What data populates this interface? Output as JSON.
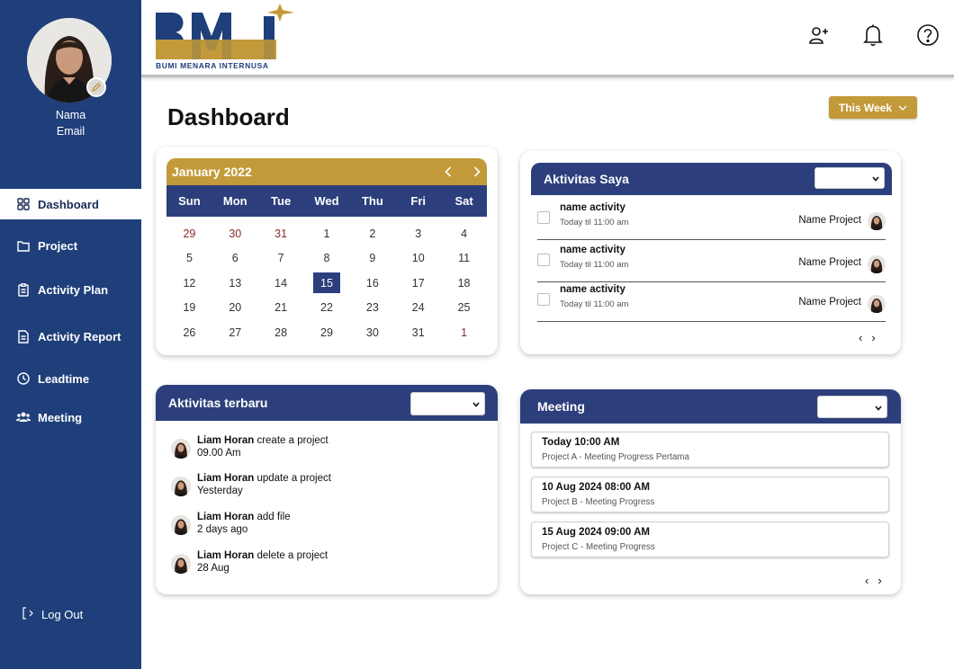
{
  "brand": {
    "logo_text": "BMI",
    "subtitle": "BUMI MENARA INTERNUSA",
    "colors": {
      "navy": "#1f3f7a",
      "gold": "#c39a3a",
      "panel": "#2c3f7c"
    }
  },
  "profile": {
    "name": "Nama",
    "email": "Email"
  },
  "sidebar": {
    "items": [
      {
        "label": "Dashboard",
        "icon": "grid-icon",
        "active": true
      },
      {
        "label": "Project",
        "icon": "folder-icon"
      },
      {
        "label": "Activity Plan",
        "icon": "clipboard-icon"
      },
      {
        "label": "Activity Report",
        "icon": "document-icon"
      },
      {
        "label": "Leadtime",
        "icon": "clock-icon"
      },
      {
        "label": "Meeting",
        "icon": "users-icon"
      }
    ],
    "logout": "Log Out"
  },
  "header": {
    "icons": [
      "add-user-icon",
      "bell-icon",
      "help-icon"
    ]
  },
  "page": {
    "title": "Dashboard",
    "filter": "This Week"
  },
  "calendar": {
    "month": "January 2022",
    "weekdays": [
      "Sun",
      "Mon",
      "Tue",
      "Wed",
      "Thu",
      "Fri",
      "Sat"
    ],
    "days": [
      "29",
      "30",
      "31",
      "1",
      "2",
      "3",
      "4",
      "5",
      "6",
      "7",
      "8",
      "9",
      "10",
      "11",
      "12",
      "13",
      "14",
      "15",
      "16",
      "17",
      "18",
      "19",
      "20",
      "21",
      "22",
      "23",
      "24",
      "25",
      "26",
      "27",
      "28",
      "29",
      "30",
      "31",
      "1"
    ],
    "selected": "15"
  },
  "my_activities": {
    "title": "Aktivitas Saya",
    "items": [
      {
        "name": "name activity",
        "time": "Today til 11:00 am",
        "project": "Name Project"
      },
      {
        "name": "name activity",
        "time": "Today til 11:00 am",
        "project": "Name Project"
      },
      {
        "name": "name activity",
        "time": "Today til 11:00 am",
        "project": "Name Project"
      }
    ],
    "prev": "‹",
    "next": "›"
  },
  "recent": {
    "title": "Aktivitas terbaru",
    "items": [
      {
        "user": "Liam Horan",
        "action": " create a project",
        "when": "09.00 Am"
      },
      {
        "user": "Liam Horan",
        "action": " update a project",
        "when": "Yesterday"
      },
      {
        "user": "Liam Horan",
        "action": " add file",
        "when": "2 days ago"
      },
      {
        "user": "Liam Horan",
        "action": " delete a project",
        "when": "28 Aug"
      }
    ]
  },
  "meeting": {
    "title": "Meeting",
    "items": [
      {
        "time": "Today 10:00 AM",
        "desc": "Project A - Meeting Progress Pertama"
      },
      {
        "time": "10 Aug 2024 08:00 AM",
        "desc": "Project B - Meeting Progress"
      },
      {
        "time": "15 Aug 2024 09:00 AM",
        "desc": "Project C - Meeting Progress"
      }
    ],
    "prev": "‹",
    "next": "›"
  }
}
